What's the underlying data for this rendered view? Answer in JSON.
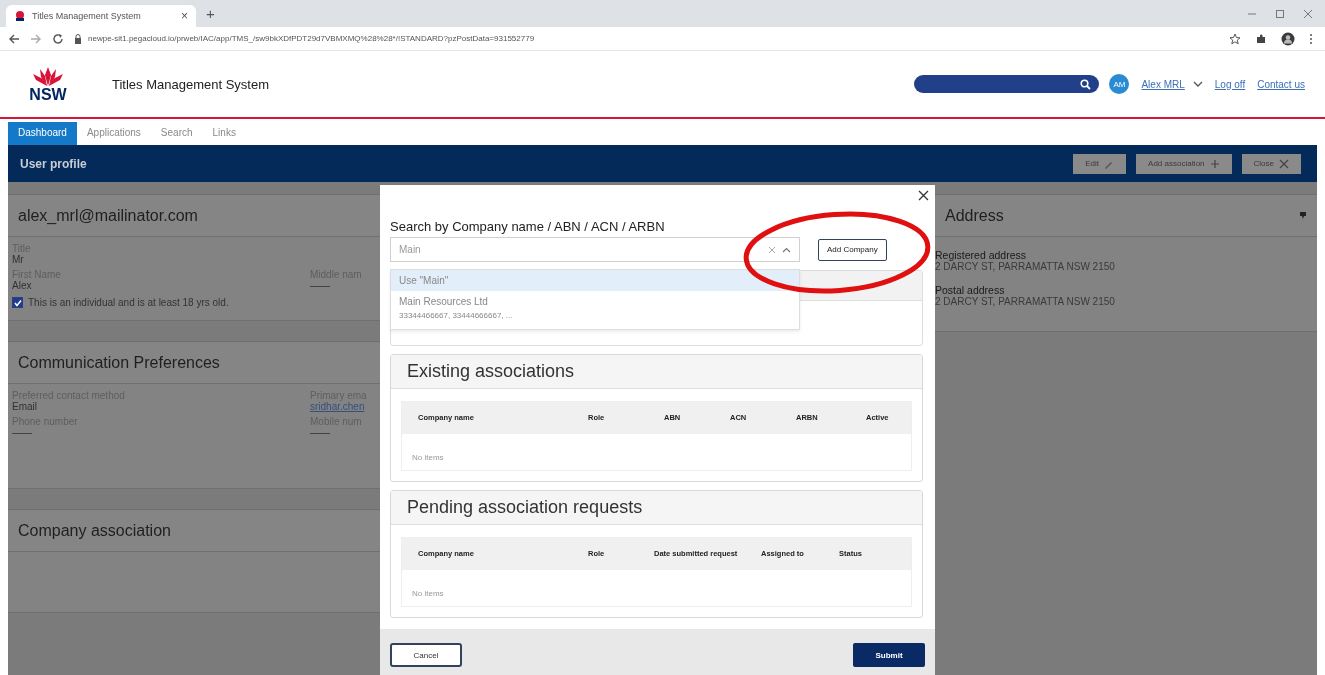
{
  "browser": {
    "tab_title": "Titles Management System",
    "tab_close": "×",
    "new_tab": "+",
    "url": "newpe-sit1.pegacloud.io/prweb/IAC/app/TMS_/sw9bkXDfPDT29d7VBMXMQ%28%28*/!STANDARD?pzPostData=931552779"
  },
  "header": {
    "logo_text": "NSW",
    "title": "Titles Management System",
    "avatar": "AM",
    "user": "Alex MRL",
    "log_off": "Log off",
    "contact": "Contact us"
  },
  "nav": [
    {
      "label": "Dashboard",
      "selected": true
    },
    {
      "label": "Applications",
      "selected": false
    },
    {
      "label": "Search",
      "selected": false
    },
    {
      "label": "Links",
      "selected": false
    }
  ],
  "page_bar": {
    "title": "User profile",
    "buttons": [
      {
        "label": "Edit",
        "kind": "edit"
      },
      {
        "label": "Add association",
        "kind": "add"
      },
      {
        "label": "Close",
        "kind": "close"
      }
    ]
  },
  "profile": {
    "title": "alex_mrl@mailinator.com",
    "rows": [
      [
        {
          "label": "Title",
          "value": "Mr"
        }
      ],
      [
        {
          "label": "First Name",
          "value": "Alex"
        },
        {
          "label": "Middle nam",
          "value": "——"
        }
      ]
    ],
    "checkbox": {
      "label": "This is an individual and is at least 18 yrs old.",
      "checked": true
    }
  },
  "communication": {
    "title": "Communication Preferences",
    "rows": [
      [
        {
          "label": "Preferred contact method",
          "value": "Email"
        },
        {
          "label": "Primary ema",
          "value": "sridhar.chen",
          "kind": "link"
        }
      ],
      [
        {
          "label": "Phone number",
          "value": "——"
        },
        {
          "label": "Mobile num",
          "value": "——"
        }
      ]
    ]
  },
  "company": {
    "title": "Company association"
  },
  "address": {
    "title": "Address",
    "items": [
      {
        "label": "Registered address",
        "value": "2 DARCY ST, PARRAMATTA NSW 2150"
      },
      {
        "label": "Postal address",
        "value": "2 DARCY ST, PARRAMATTA NSW 2150"
      }
    ]
  },
  "modal": {
    "search_label": "Search by Company name / ABN / ACN / ARBN",
    "search_value": "Main",
    "add_button": "Add Company",
    "options": [
      {
        "label": "Use \"Main\"",
        "selected": true
      },
      {
        "label": "Main Resources Ltd",
        "detail": "33344466667, 33444666667, ...",
        "selected": false
      }
    ],
    "sections": [
      {
        "title": "Existing associations",
        "columns": [
          "Company name",
          "Role",
          "ABN",
          "ACN",
          "ARBN",
          "Active"
        ],
        "empty": "No items"
      },
      {
        "title": "Pending association requests",
        "columns": [
          "Company name",
          "Role",
          "Date submitted request",
          "Assigned to",
          "Status"
        ],
        "empty": "No items"
      }
    ],
    "cancel": "Cancel",
    "submit": "Submit"
  }
}
